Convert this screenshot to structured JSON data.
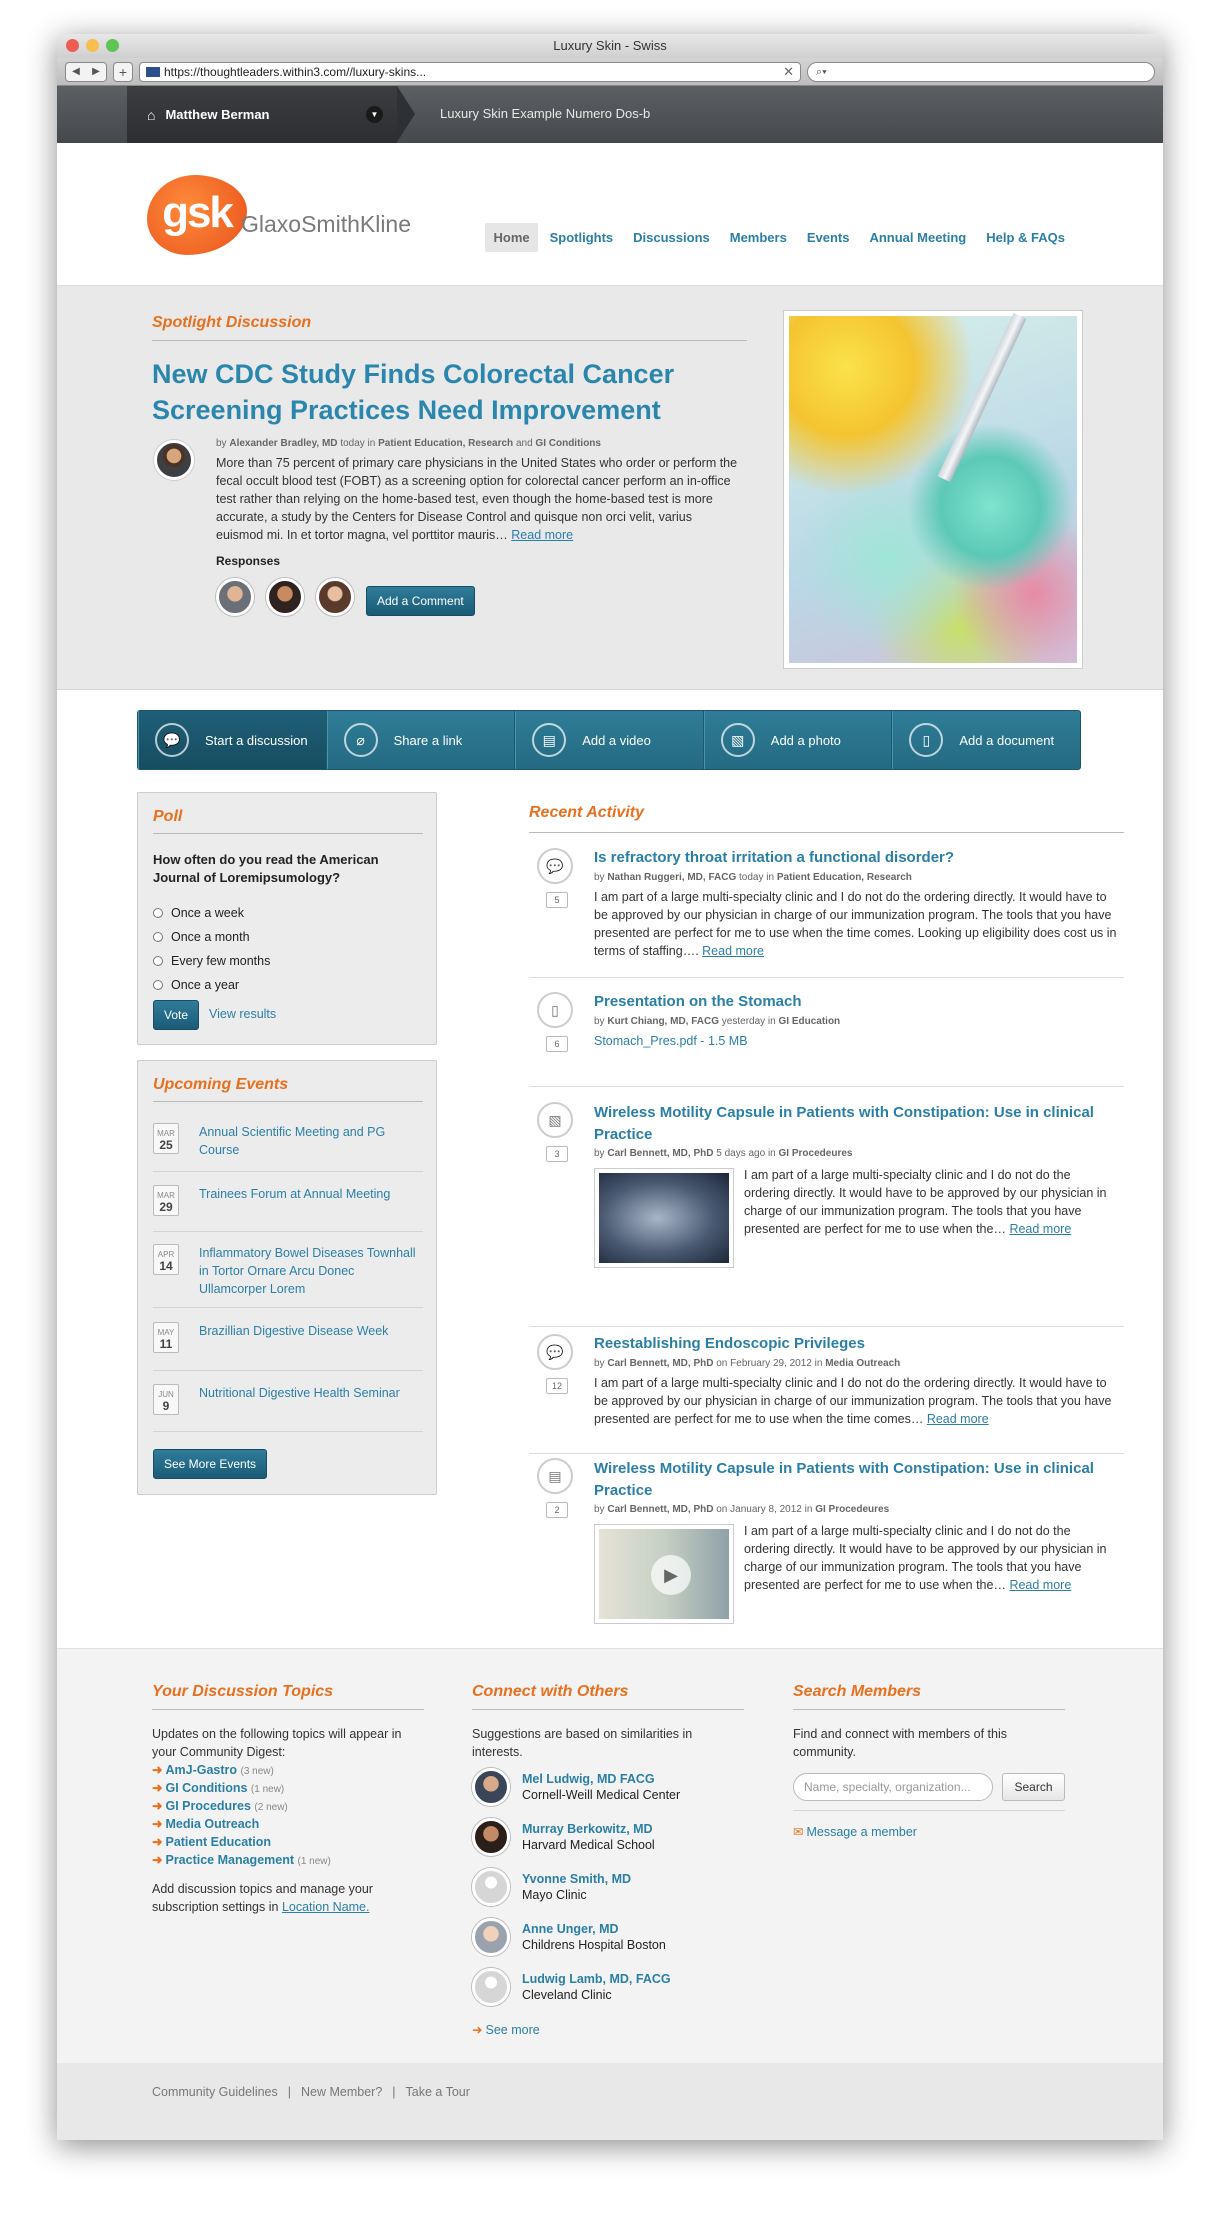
{
  "browser": {
    "title": "Luxury Skin - Swiss",
    "url": "https://thoughtleaders.within3.com//luxury-skins...",
    "search_placeholder": "Q"
  },
  "topbar": {
    "user_name": "Matthew Berman",
    "breadcrumb": "Luxury Skin Example Numero Dos-b"
  },
  "logo": {
    "mark": "gsk",
    "name": "GlaxoSmithKline"
  },
  "nav": [
    "Home",
    "Spotlights",
    "Discussions",
    "Members",
    "Events",
    "Annual Meeting",
    "Help & FAQs"
  ],
  "spotlight": {
    "label": "Spotlight Discussion",
    "title": "New CDC Study Finds Colorectal Cancer Screening Practices Need Improvement",
    "by": "by",
    "author": "Alexander Bradley, MD",
    "when": "today in",
    "cats": "Patient Education, Research",
    "and": "and",
    "cat2": "GI Conditions",
    "text": "More than 75 percent of primary care physicians in the United States who order or perform the fecal occult blood test (FOBT) as a screening option for colorectal cancer perform an in-office test rather than relying on the home-based test, even though the home-based test is more accurate, a study by the Centers for Disease Control and quisque non orci velit, varius euismod mi. In et tortor magna, vel porttitor mauris…",
    "read_more": "Read more",
    "responses_label": "Responses",
    "add_comment": "Add a Comment"
  },
  "actions": [
    "Start a discussion",
    "Share a link",
    "Add a video",
    "Add a photo",
    "Add a document"
  ],
  "poll": {
    "title": "Poll",
    "question": "How often do you read the American Journal of Loremipsumology?",
    "options": [
      "Once a week",
      "Once a month",
      "Every few months",
      "Once a year"
    ],
    "vote": "Vote",
    "view_results": "View results"
  },
  "events": {
    "title": "Upcoming Events",
    "items": [
      {
        "mon": "MAR",
        "day": "25",
        "name": "Annual Scientific Meeting and PG Course"
      },
      {
        "mon": "MAR",
        "day": "29",
        "name": "Trainees Forum at Annual Meeting"
      },
      {
        "mon": "APR",
        "day": "14",
        "name": "Inflammatory Bowel Diseases Townhall in Tortor Ornare Arcu Donec Ullamcorper Lorem"
      },
      {
        "mon": "MAY",
        "day": "11",
        "name": "Brazillian Digestive Disease Week"
      },
      {
        "mon": "JUN",
        "day": "9",
        "name": "Nutritional Digestive Health Seminar"
      }
    ],
    "see_more": "See More Events"
  },
  "recent": {
    "title": "Recent Activity",
    "items": [
      {
        "count": "5",
        "title": "Is refractory throat irritation a functional disorder?",
        "author": "Nathan Ruggeri, MD, FACG",
        "when": "today in",
        "cats": "Patient Education, Research",
        "text": "I am part of a large multi-specialty clinic and I do not do the ordering directly. It would have to be approved by our physician in charge of our immunization program. The tools that you have presented are perfect for me to use when the time comes. Looking up eligibility does cost us in terms of staffing….",
        "more": "Read more"
      },
      {
        "count": "6",
        "title": "Presentation on the Stomach",
        "author": "Kurt Chiang, MD, FACG",
        "when": "yesterday in",
        "cats": "GI Education",
        "file": "Stomach_Pres.pdf - 1.5 MB"
      },
      {
        "count": "3",
        "title": "Wireless Motility Capsule in Patients with Constipation: Use in clinical Practice",
        "author": "Carl Bennett, MD, PhD",
        "when": "5 days ago in",
        "cats": "GI Procedeures",
        "text": "I am part of a large multi-specialty clinic and I do not do the ordering directly. It would have to be approved by our physician in charge of our immunization program. The tools that you have presented are perfect for me to use when the…",
        "more": "Read more"
      },
      {
        "count": "12",
        "title": "Reestablishing Endoscopic Privileges",
        "author": "Carl Bennett, MD, PhD",
        "when": "on February 29, 2012 in",
        "cats": "Media Outreach",
        "text": "I am part of a large multi-specialty clinic and I do not do the ordering directly. It would have to be approved by our physician in charge of our immunization program. The tools that you have presented are perfect for me to use when the time comes…",
        "more": "Read more"
      },
      {
        "count": "2",
        "title": "Wireless Motility Capsule in Patients with Constipation: Use in clinical Practice",
        "author": "Carl Bennett, MD, PhD",
        "when": "on January 8, 2012 in",
        "cats": "GI Procedeures",
        "text": "I am part of a large multi-specialty clinic and I do not do the ordering directly. It would have to be approved by our physician in charge of our immunization program. The tools that you have presented are perfect for me to use when the…",
        "more": "Read more"
      }
    ]
  },
  "topics": {
    "title": "Your Discussion Topics",
    "intro": "Updates on the following topics will appear in your Community Digest:",
    "items": [
      {
        "name": "AmJ-Gastro",
        "new": "(3 new)"
      },
      {
        "name": "GI Conditions",
        "new": "(1 new)"
      },
      {
        "name": "GI Procedures",
        "new": "(2 new)"
      },
      {
        "name": "Media Outreach",
        "new": ""
      },
      {
        "name": "Patient Education",
        "new": ""
      },
      {
        "name": "Practice Management",
        "new": "(1 new)"
      }
    ],
    "outro": "Add discussion topics and manage your subscription settings in",
    "outro_link": "Location Name."
  },
  "connect": {
    "title": "Connect with Others",
    "intro": "Suggestions are based on similarities in interests.",
    "people": [
      {
        "name": "Mel Ludwig, MD FACG",
        "org": "Cornell-Weill Medical Center"
      },
      {
        "name": "Murray Berkowitz, MD",
        "org": "Harvard Medical School"
      },
      {
        "name": "Yvonne Smith, MD",
        "org": "Mayo Clinic"
      },
      {
        "name": "Anne Unger, MD",
        "org": "Childrens Hospital Boston"
      },
      {
        "name": "Ludwig Lamb, MD, FACG",
        "org": "Cleveland Clinic"
      }
    ],
    "see_more": "See more"
  },
  "search_members": {
    "title": "Search Members",
    "intro": "Find and connect with members of this community.",
    "placeholder": "Name, specialty, organization...",
    "button": "Search",
    "message": "Message a member"
  },
  "footer": {
    "links": [
      "Community Guidelines",
      "New Member?",
      "Take a Tour"
    ]
  }
}
